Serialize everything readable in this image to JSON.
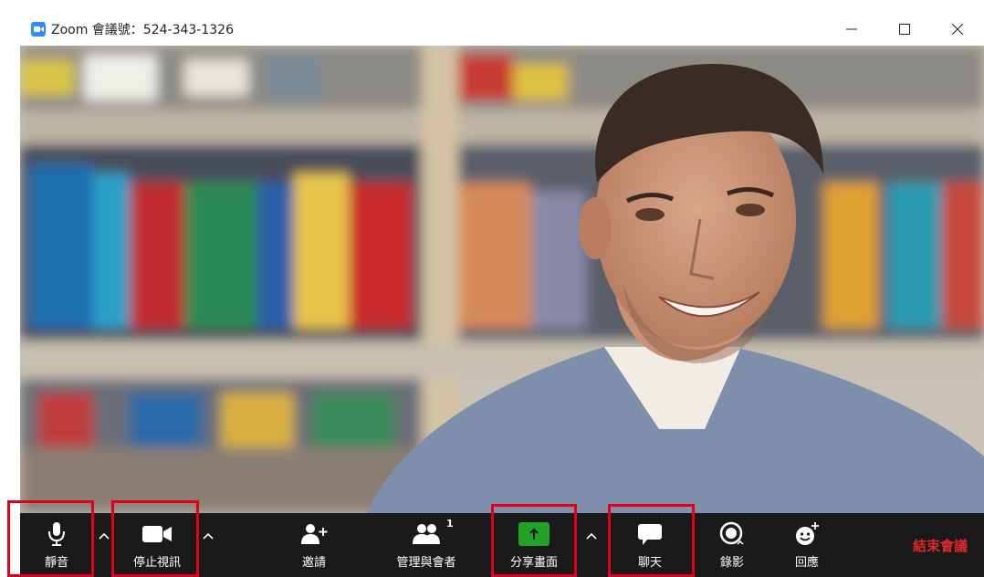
{
  "window": {
    "title": "Zoom 會議號：524-343-1326",
    "controls": [
      "minimize",
      "maximize",
      "close"
    ]
  },
  "toolbar": {
    "mute_label": "靜音",
    "stop_video_label": "停止視訊",
    "invite_label": "邀請",
    "participants_label": "管理與會者",
    "participants_count": "1",
    "share_label": "分享畫面",
    "chat_label": "聊天",
    "record_label": "錄影",
    "reactions_label": "回應",
    "end_label": "結束會議"
  },
  "colors": {
    "toolbar_bg": "#1a1a1a",
    "share_green": "#23a12a",
    "end_red": "#e02828",
    "highlight_red": "#e0001a",
    "zoom_blue": "#2d8cff"
  },
  "highlighted_buttons": [
    "mute",
    "stop-video",
    "share",
    "chat"
  ]
}
